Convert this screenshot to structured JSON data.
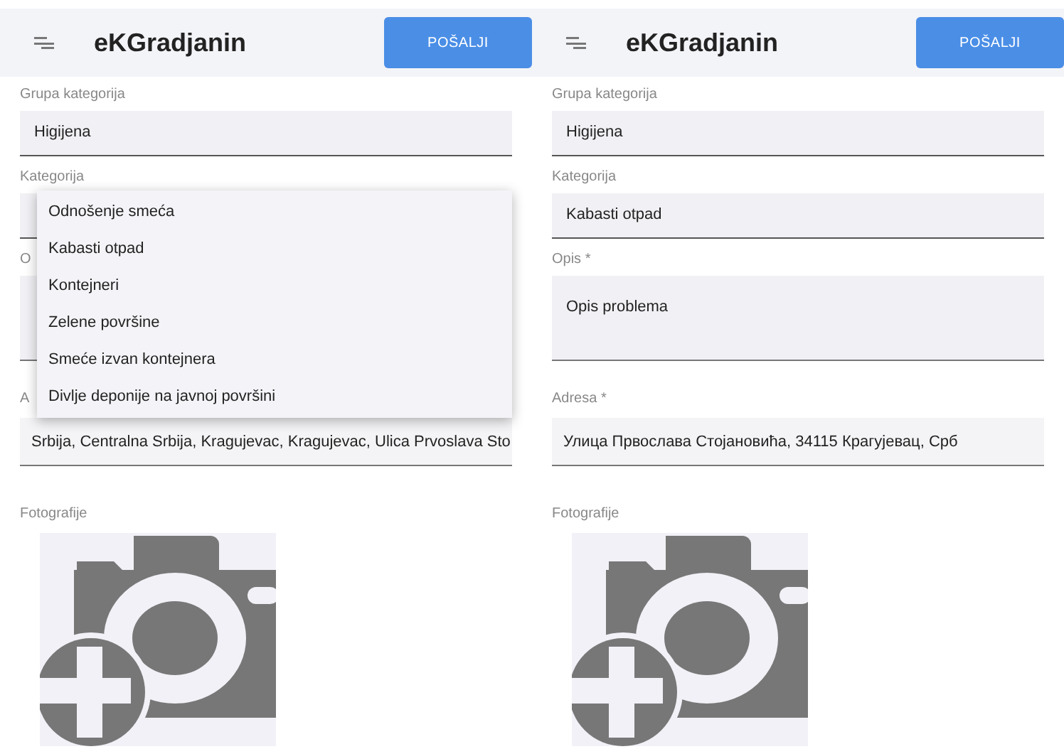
{
  "screens": [
    {
      "header": {
        "title": "eKGradjanin",
        "button": "POŠALJI"
      },
      "fields": [
        {
          "kind": "select",
          "label": "Grupa kategorija",
          "value": "Higijena"
        },
        {
          "kind": "select",
          "label": "Kategorija"
        },
        {
          "kind": "textarea",
          "label": "O"
        },
        {
          "kind": "address",
          "label": "A",
          "value": "Srbija, Centralna Srbija, Kragujevac, Kragujevac, Ulica Prvoslava Sto"
        }
      ],
      "dropdown": {
        "options": [
          "Odnošenje smeća",
          "Kabasti otpad",
          "Kontejneri",
          "Zelene površine",
          "Smeće izvan kontejnera",
          "Divlje deponije na javnoj površini"
        ]
      },
      "photos_label": "Fotografije"
    },
    {
      "header": {
        "title": "eKGradjanin",
        "button": "POŠALJI"
      },
      "fields": [
        {
          "kind": "select",
          "label": "Grupa kategorija",
          "value": "Higijena"
        },
        {
          "kind": "select",
          "label": "Kategorija",
          "value": "Kabasti otpad"
        },
        {
          "kind": "textarea",
          "label": "Opis *",
          "value": "Opis problema"
        },
        {
          "kind": "address",
          "label": "Adresa *",
          "value": "Улица Првослава Стојановића, 34115 Крагујевац, Срб"
        }
      ],
      "photos_label": "Fotografije"
    }
  ]
}
